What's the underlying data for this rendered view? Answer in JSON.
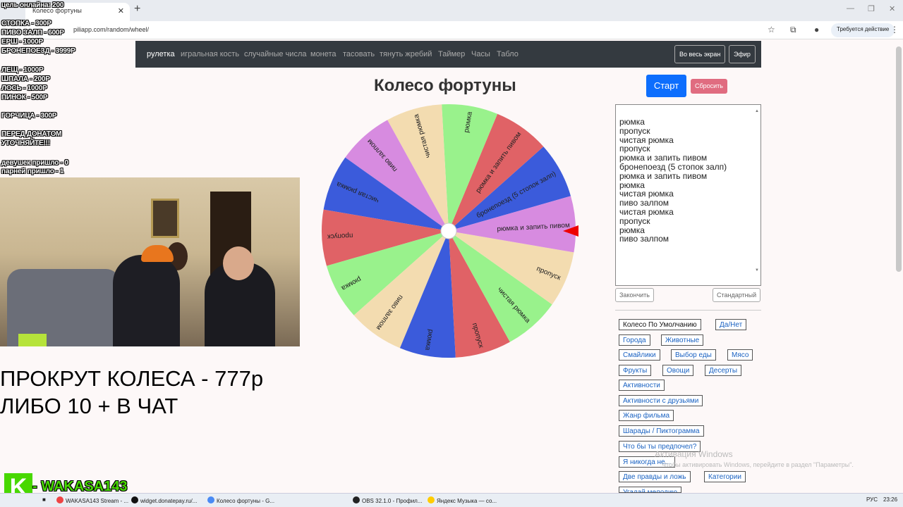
{
  "browser": {
    "tab_title": "Колесо фортуны",
    "url": "piliapp.com/random/wheel/",
    "profile_button": "Требуется действие"
  },
  "nav": {
    "links": [
      "рулетка",
      "игральная кость",
      "случайные числа",
      "монета",
      "тасовать",
      "тянуть жребий",
      "Таймер",
      "Часы",
      "Табло"
    ],
    "fullscreen_label": "Во весь экран",
    "broadcast_label": "Эфир"
  },
  "wheel": {
    "title": "Колесо фортуны",
    "start_label": "Старт",
    "reset_label": "Сбросить",
    "segments": [
      {
        "label": "бронепоезд (5 стопок залп)",
        "color": "#3b5bdb"
      },
      {
        "label": "рюмка и запить пивом",
        "color": "#e06266"
      },
      {
        "label": "рюмка",
        "color": "#99f28c"
      },
      {
        "label": "чистая рюмка",
        "color": "#f3dcb0"
      },
      {
        "label": "пиво залпом",
        "color": "#d78be0"
      },
      {
        "label": "чистая рюмка",
        "color": "#3b5bdb"
      },
      {
        "label": "пропуск",
        "color": "#e06266"
      },
      {
        "label": "рюмка",
        "color": "#99f28c"
      },
      {
        "label": "пиво залпом",
        "color": "#f3dcb0"
      },
      {
        "label": "рюмка",
        "color": "#3b5bdb"
      },
      {
        "label": "пропуск",
        "color": "#e06266"
      },
      {
        "label": "чистая рюмка",
        "color": "#99f28c"
      },
      {
        "label": "пропуск",
        "color": "#f3dcb0"
      },
      {
        "label": "рюмка и запить пивом",
        "color": "#d78be0"
      }
    ]
  },
  "entries": {
    "lines": [
      "рюмка",
      "пропуск",
      "чистая рюмка",
      "пропуск",
      "рюмка и запить пивом",
      "бронепоезд (5 стопок залп)",
      "рюмка и запить пивом",
      "рюмка",
      "чистая рюмка",
      "пиво залпом",
      "чистая рюмка",
      "пропуск",
      "рюмка",
      "пиво залпом"
    ],
    "finish_label": "Закончить",
    "standard_label": "Стандартный"
  },
  "presets": [
    "Колесо По Умолчанию",
    "Да/Нет",
    "Города",
    "Животные",
    "Смайлики",
    "Выбор еды",
    "Мясо",
    "Фрукты",
    "Овощи",
    "Десерты",
    "Активности",
    "Активности с друзьями",
    "Жанр фильма",
    "Шарады / Пиктограмма",
    "Что бы ты предпочел?",
    "Я никогда не...",
    "Две правды и ложь",
    "Категории",
    "Угадай мелодию"
  ],
  "watermark": {
    "line1": "Активация Windows",
    "line2": "Чтобы активировать Windows, перейдите в раздел \"Параметры\"."
  },
  "overlay": {
    "goal": "цель онлайна: 200",
    "prices_a": [
      "СТОПКА - 300Р",
      "ПИВО ЗАЛП - 600Р",
      "ЕРШ - 1000Р",
      "БРОНЕПОЕЗД - 3999Р"
    ],
    "prices_b": [
      "ЛЕЩ - 1000Р",
      "ШПАЛА - 200Р",
      "ЛОСЬ - 1000Р",
      "ПИНОК - 500Р"
    ],
    "mustard": "ГОРЧИЦА - 300Р",
    "donate_note": [
      "ПЕРЕД ДОНАТОМ",
      "УТОЧНЯЙТЕ!!!"
    ],
    "girls": "девушек пришло - 0",
    "guys": "парней пришло - 1",
    "spin_line1": "ПРОКРУТ КОЛЕСА - 777р",
    "spin_line2": "ЛИБО 10 + В ЧАТ",
    "logo_letter": "K",
    "logo_name": "- WAKASA143"
  },
  "taskbar": {
    "items": [
      {
        "label": "WAKASA143 Stream - ...",
        "color": "#e44"
      },
      {
        "label": "widget.donatepay.ru/...",
        "color": "#111"
      },
      {
        "label": "Колесо фортуны - G...",
        "color": "#4a8af4"
      },
      {
        "label": "OBS 32.1.0 - Профил...",
        "color": "#222"
      },
      {
        "label": "Яндекс Музыка — со...",
        "color": "#fc0"
      }
    ],
    "lang": "РУС",
    "time": "23:26"
  }
}
